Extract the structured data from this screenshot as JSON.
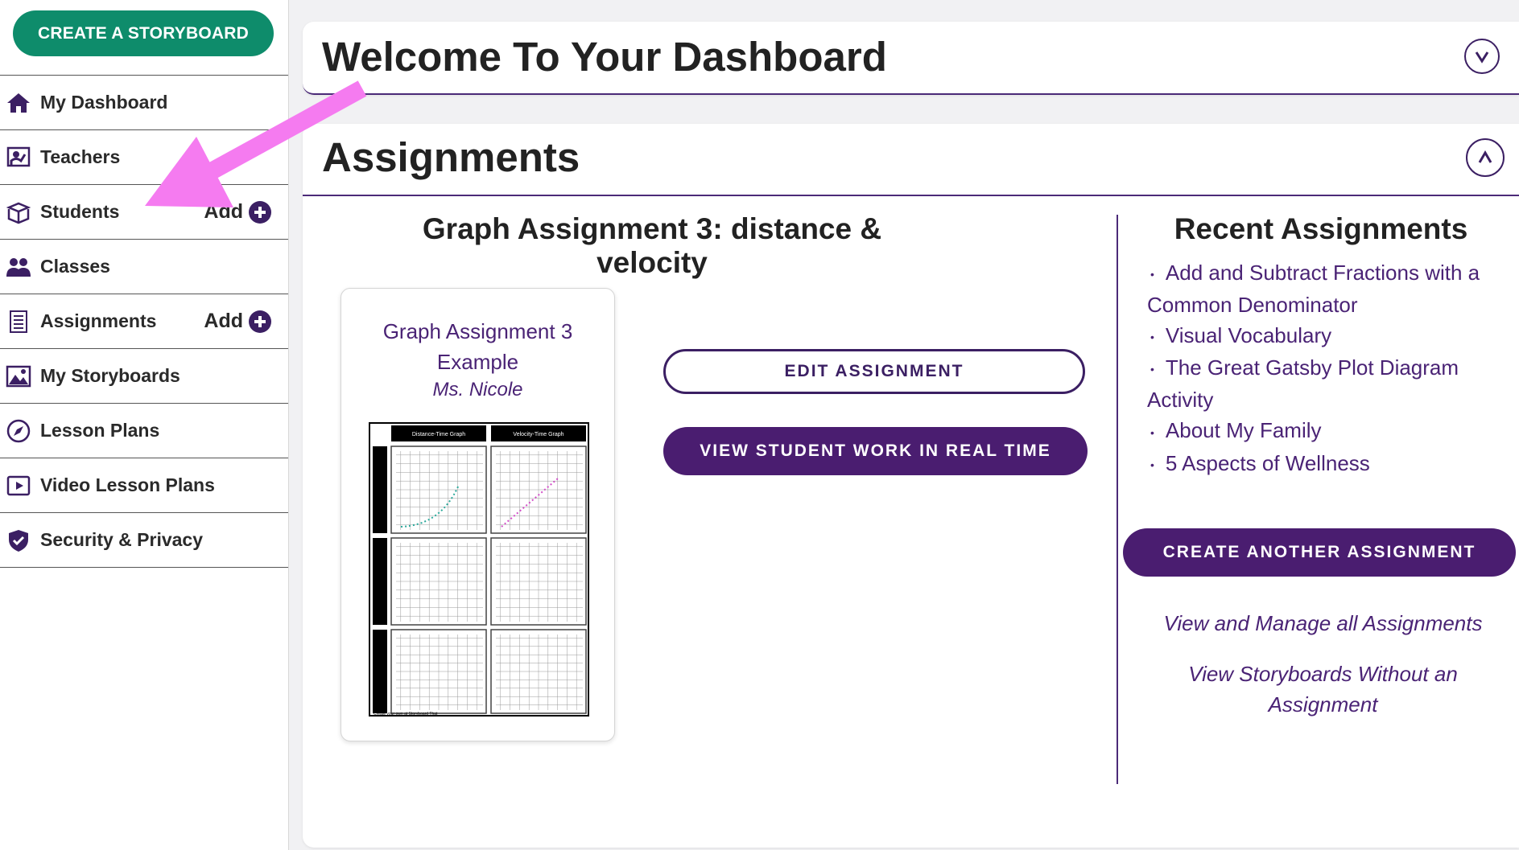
{
  "sidebar": {
    "create_button": "CREATE A STORYBOARD",
    "items": [
      {
        "label": "My Dashboard"
      },
      {
        "label": "Teachers"
      },
      {
        "label": "Students",
        "add": "Add"
      },
      {
        "label": "Classes"
      },
      {
        "label": "Assignments",
        "add": "Add"
      },
      {
        "label": "My Storyboards"
      },
      {
        "label": "Lesson Plans"
      },
      {
        "label": "Video Lesson Plans"
      },
      {
        "label": "Security & Privacy"
      }
    ]
  },
  "welcome": {
    "title": "Welcome To Your Dashboard",
    "toggle": "V"
  },
  "assignments": {
    "title": "Assignments",
    "toggle": "Λ",
    "current": {
      "title": "Graph Assignment 3: distance & velocity",
      "card_title": "Graph Assignment 3 Example",
      "card_author": "Ms. Nicole",
      "edit_button": "EDIT ASSIGNMENT",
      "view_button": "VIEW STUDENT WORK IN REAL TIME",
      "thumb_col1": "Distance-Time Graph",
      "thumb_col2": "Velocity-Time Graph",
      "thumb_footer": "Create your own at Storyboard That"
    },
    "recent": {
      "heading": "Recent Assignments",
      "items": [
        "Add and Subtract Fractions with a Common Denominator",
        "Visual Vocabulary",
        "The Great Gatsby Plot Diagram Activity",
        "About My Family",
        "5 Aspects of Wellness"
      ],
      "create_another": "CREATE ANOTHER ASSIGNMENT",
      "manage_link": "View and Manage all Assignments",
      "no_assignment_link": "View Storyboards Without an Assignment"
    }
  },
  "colors": {
    "brand_green": "#0e8c6b",
    "brand_purple": "#4a1d70",
    "annotation_pink": "#f57bf0"
  }
}
